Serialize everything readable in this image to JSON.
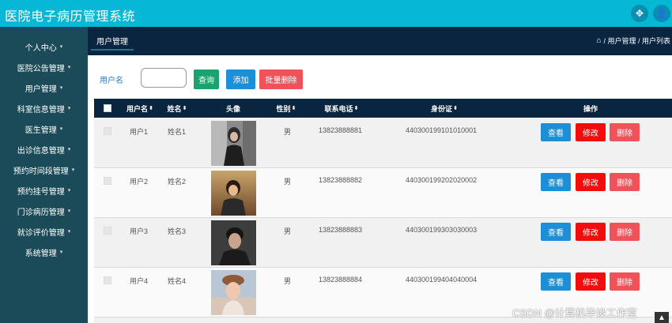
{
  "app": {
    "title": "医院电子病历管理系统",
    "brand_color": "#06b7d6"
  },
  "top_actions": [
    {
      "icon": "fullscreen-icon",
      "glyph": "✥"
    },
    {
      "icon": "user-icon",
      "glyph": "👤"
    }
  ],
  "sidebar": {
    "items": [
      {
        "label": "个人中心"
      },
      {
        "label": "医院公告管理"
      },
      {
        "label": "用户管理"
      },
      {
        "label": "科室信息管理"
      },
      {
        "label": "医生管理"
      },
      {
        "label": "出诊信息管理"
      },
      {
        "label": "预约时间段管理"
      },
      {
        "label": "预约挂号管理"
      },
      {
        "label": "门诊病历管理"
      },
      {
        "label": "就诊评价管理"
      },
      {
        "label": "系统管理"
      }
    ],
    "caret": "▾"
  },
  "navbar": {
    "tab": "用户管理",
    "home_glyph": "⌂",
    "breadcrumb": "/ 用户管理 / 用户列表"
  },
  "search": {
    "label": "用户名",
    "placeholder": "",
    "value": "",
    "query_button": "查询",
    "add_button": "添加",
    "batch_delete_button": "批量删除"
  },
  "table": {
    "columns": [
      "用户名",
      "姓名",
      "头像",
      "性别",
      "联系电话",
      "身份证",
      "操作"
    ],
    "sort_glyph": "⬍",
    "rows": [
      {
        "username": "用户1",
        "name": "姓名1",
        "gender": "男",
        "phone": "13823888881",
        "id_card": "440300199101010001"
      },
      {
        "username": "用户2",
        "name": "姓名2",
        "gender": "男",
        "phone": "13823888882",
        "id_card": "440300199202020002"
      },
      {
        "username": "用户3",
        "name": "姓名3",
        "gender": "男",
        "phone": "13823888883",
        "id_card": "440300199303030003"
      },
      {
        "username": "用户4",
        "name": "姓名4",
        "gender": "男",
        "phone": "13823888884",
        "id_card": "440300199404040004"
      }
    ],
    "actions": {
      "view": "查看",
      "edit": "修改",
      "delete": "删除"
    }
  },
  "watermark": "CSDN @计算机毕设工作室",
  "scroll_top_glyph": "▲"
}
